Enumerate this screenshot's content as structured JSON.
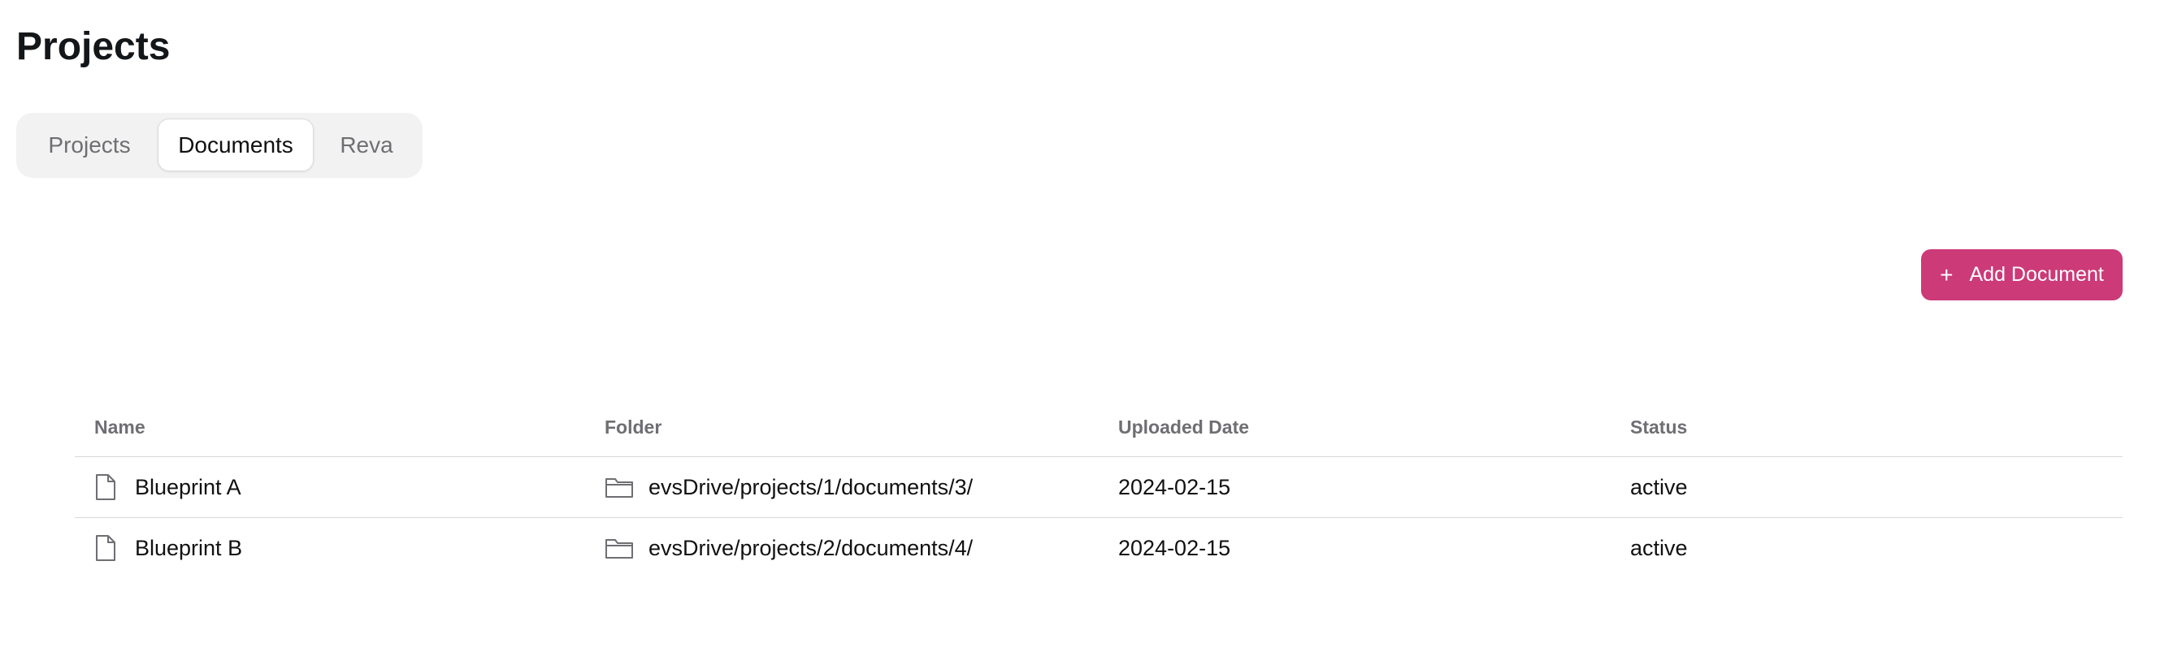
{
  "page": {
    "title": "Projects"
  },
  "tabs": [
    {
      "label": "Projects",
      "active": false
    },
    {
      "label": "Documents",
      "active": true
    },
    {
      "label": "Reva",
      "active": false
    }
  ],
  "toolbar": {
    "add_label": "Add Document",
    "add_icon": "plus-icon",
    "accent": "#cc3a78"
  },
  "table": {
    "columns": [
      "Name",
      "Folder",
      "Uploaded Date",
      "Status"
    ],
    "rows": [
      {
        "name": "Blueprint A",
        "name_icon": "document-icon",
        "folder": "evsDrive/projects/1/documents/3/",
        "folder_icon": "folder-icon",
        "uploaded": "2024-02-15",
        "status": "active"
      },
      {
        "name": "Blueprint B",
        "name_icon": "document-icon",
        "folder": "evsDrive/projects/2/documents/4/",
        "folder_icon": "folder-icon",
        "uploaded": "2024-02-15",
        "status": "active"
      }
    ]
  }
}
